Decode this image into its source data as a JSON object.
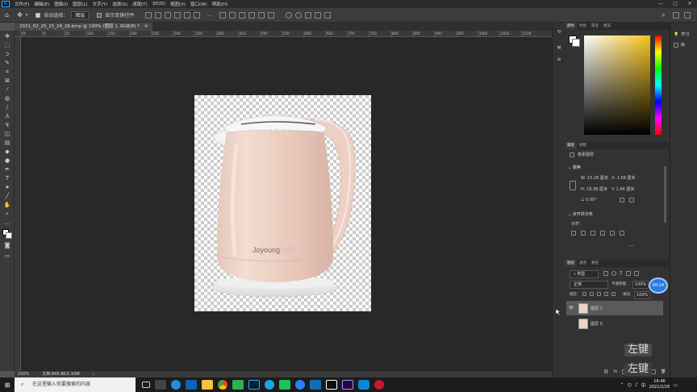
{
  "app": {
    "icon_label": "Ps"
  },
  "menu": [
    "文件(F)",
    "编辑(E)",
    "图像(I)",
    "图层(L)",
    "文字(Y)",
    "选择(S)",
    "滤镜(T)",
    "3D(D)",
    "视图(V)",
    "窗口(W)",
    "帮助(H)"
  ],
  "options": {
    "auto_select_label": "自动选择：",
    "auto_select_value": "图层",
    "show_transform_label": "显示变换控件"
  },
  "document": {
    "tab_title": "2021_02_25_15_24_28.bmp @ 100% (图层 1, RGB/8) *"
  },
  "ruler_ticks": [
    "50",
    "0",
    "50",
    "100",
    "150",
    "200",
    "250",
    "300",
    "350",
    "400",
    "450",
    "500",
    "550",
    "600",
    "650",
    "700",
    "750",
    "800",
    "850",
    "900",
    "950",
    "1000",
    "1050",
    "1100"
  ],
  "brand_text": {
    "prefix": "Joyoung",
    "suffix": "九阳"
  },
  "status": {
    "zoom": "100%",
    "doc_info": "文档:845.8K/1.93M"
  },
  "color_panel": {
    "tabs": [
      "颜色",
      "色板",
      "渐变",
      "图案"
    ]
  },
  "properties": {
    "tabs": [
      "属性",
      "调整"
    ],
    "layer_type": "像素图层",
    "transform_title": "变换",
    "w": "W: 15.28 厘米",
    "x": "X: 1.69 厘米",
    "h": "H: 18.38 厘米",
    "y": "Y: 1.94 厘米",
    "angle": "0.00°",
    "align_title": "对齐并分布",
    "align_sub": "对齐："
  },
  "layers_panel": {
    "tabs": [
      "图层",
      "通道",
      "路径"
    ],
    "filter": "类型",
    "blend": "正常",
    "opacity_label": "不透明度:",
    "opacity": "100%",
    "lock_label": "锁定:",
    "fill_label": "填充:",
    "fill": "100%",
    "timer": "00:14",
    "layers": [
      {
        "name": "图层 1",
        "selected": true
      },
      {
        "name": "图层 0",
        "selected": false
      }
    ]
  },
  "right_dock": [
    {
      "label": "学习"
    },
    {
      "label": "库"
    }
  ],
  "watermark_keys": [
    "左键",
    "左键"
  ],
  "taskbar": {
    "search_placeholder": "在这里输入你要搜索的内容",
    "time": "16:46",
    "date": "2021/2/26"
  }
}
